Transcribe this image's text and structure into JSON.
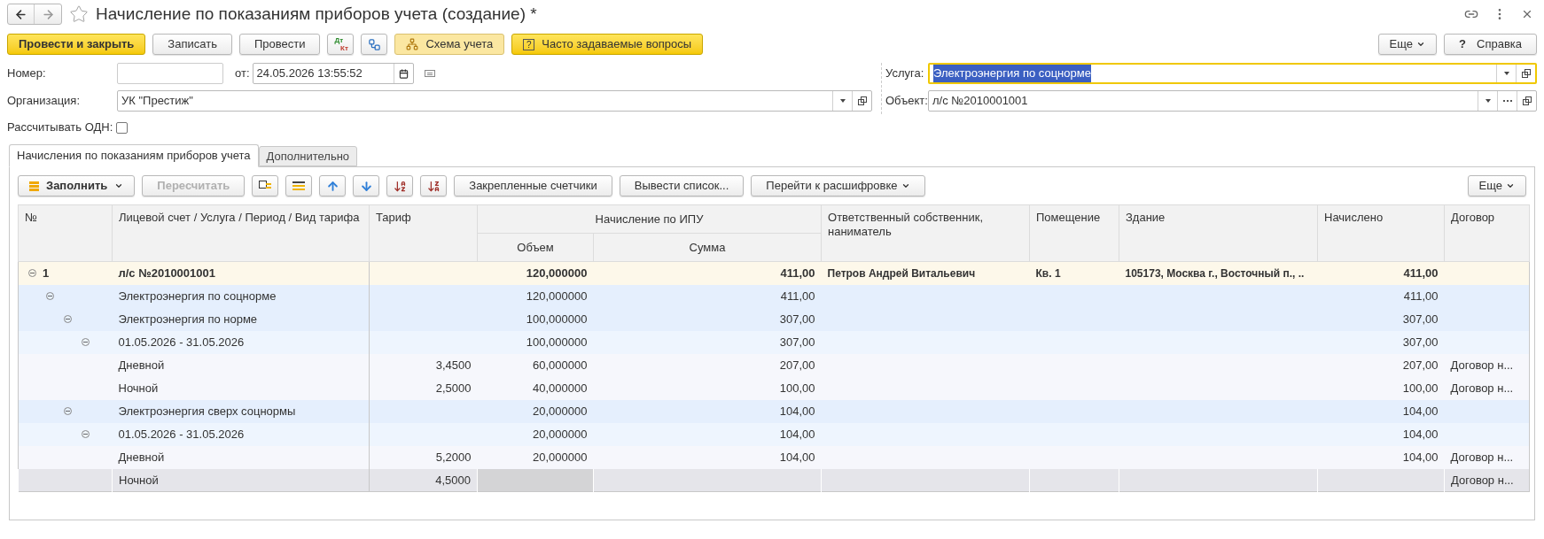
{
  "window": {
    "title": "Начисление по показаниям приборов учета (создание) *"
  },
  "toolbar": [
    {
      "kind": "primary",
      "label": "Провести и закрыть"
    },
    {
      "kind": "default",
      "label": "Записать"
    },
    {
      "kind": "default",
      "label": "Провести"
    },
    {
      "kind": "posting",
      "debit": "Дт",
      "credit": "Кт"
    },
    {
      "kind": "structure"
    },
    {
      "kind": "scheme",
      "label": "Схема учета"
    },
    {
      "kind": "faq",
      "mark": "?",
      "label": "Часто задаваемые вопросы"
    }
  ],
  "toolbar_right": {
    "more": "Еще",
    "help_mark": "?",
    "help": "Справка"
  },
  "form": {
    "number": {
      "label": "Номер:"
    },
    "date": {
      "label": "от:",
      "value": "24.05.2026 13:55:52"
    },
    "organization": {
      "label": "Организация:",
      "value": "УК \"Престиж\""
    },
    "odn": {
      "label": "Рассчитывать ОДН:",
      "checked": false
    },
    "service": {
      "label": "Услуга:",
      "value": "Электроэнергия по соцнорме",
      "focused": true
    },
    "object": {
      "label": "Объект:",
      "value": "л/с №2010001001",
      "focused": false
    }
  },
  "tabs": [
    {
      "label": "Начисления по показаниям приборов учета",
      "selected": true
    },
    {
      "label": "Дополнительно",
      "selected": false
    }
  ],
  "table_toolbar": {
    "fill": "Заполнить",
    "recalc": {
      "label": "Пересчитать",
      "disabled": true
    },
    "pinned": "Закрепленные счетчики",
    "list": "Вывести список...",
    "drill": "Перейти к расшифровке",
    "more": "Еще"
  },
  "table": {
    "columns": [
      {
        "label": "№"
      },
      {
        "label": "Лицевой счет / Услуга / Период / Вид тарифа"
      },
      {
        "label": "Тариф"
      },
      {
        "label": "Начисление по ИПУ",
        "children": [
          {
            "label": "Объем"
          },
          {
            "label": "Сумма"
          }
        ]
      },
      {
        "label": "Ответственный собственник, наниматель"
      },
      {
        "label": "Помещение"
      },
      {
        "label": "Здание"
      },
      {
        "label": "Начислено"
      },
      {
        "label": "Договор"
      }
    ],
    "rows": [
      {
        "number": "1",
        "account": "л/с №2010001001",
        "volume": "120,000000",
        "sum": "411,00",
        "owner": "Петров Андрей Витальевич",
        "room": "Кв. 1",
        "building": "105173, Москва г., Восточный п., ..",
        "charged": "411,00",
        "expanded": true,
        "selected": false,
        "children": [
          {
            "account": "Электроэнергия по соцнорме",
            "volume": "120,000000",
            "sum": "411,00",
            "charged": "411,00",
            "expanded": true,
            "selected": false,
            "children": [
              {
                "account": "Электроэнергия по норме",
                "volume": "100,000000",
                "sum": "307,00",
                "charged": "307,00",
                "expanded": true,
                "selected": false,
                "children": [
                  {
                    "account": "01.05.2026 - 31.05.2026",
                    "volume": "100,000000",
                    "sum": "307,00",
                    "charged": "307,00",
                    "expanded": true,
                    "selected": false,
                    "children": [
                      {
                        "account": "Дневной",
                        "tariff": "3,4500",
                        "volume": "60,000000",
                        "sum": "207,00",
                        "charged": "207,00",
                        "contract": "Договор н...",
                        "selected": false
                      },
                      {
                        "account": "Ночной",
                        "tariff": "2,5000",
                        "volume": "40,000000",
                        "sum": "100,00",
                        "charged": "100,00",
                        "contract": "Договор н...",
                        "selected": false
                      }
                    ]
                  }
                ]
              },
              {
                "account": "Электроэнергия сверх соцнормы",
                "volume": "20,000000",
                "sum": "104,00",
                "charged": "104,00",
                "expanded": true,
                "selected": false,
                "children": [
                  {
                    "account": "01.05.2026 - 31.05.2026",
                    "volume": "20,000000",
                    "sum": "104,00",
                    "charged": "104,00",
                    "expanded": true,
                    "selected": false,
                    "children": [
                      {
                        "account": "Дневной",
                        "tariff": "5,2000",
                        "volume": "20,000000",
                        "sum": "104,00",
                        "charged": "104,00",
                        "contract": "Договор н...",
                        "selected": false
                      },
                      {
                        "account": "Ночной",
                        "tariff": "4,5000",
                        "contract": "Договор н...",
                        "selected": true,
                        "volume_focused": true
                      }
                    ]
                  }
                ]
              }
            ]
          }
        ]
      }
    ]
  }
}
